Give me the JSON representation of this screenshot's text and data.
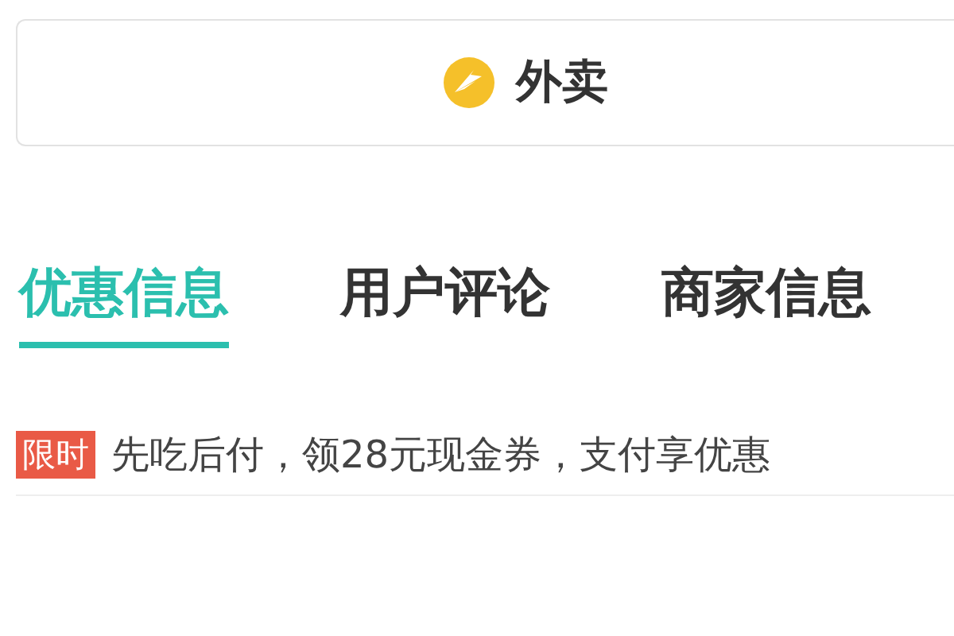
{
  "delivery_button": {
    "label": "外卖"
  },
  "tabs": [
    {
      "label": "优惠信息",
      "selected": true
    },
    {
      "label": "用户评论",
      "selected": false
    },
    {
      "label": "商家信息",
      "selected": false
    }
  ],
  "promotions": [
    {
      "tag": "限时",
      "text": "先吃后付，领28元现金券，支付享优惠"
    }
  ]
}
